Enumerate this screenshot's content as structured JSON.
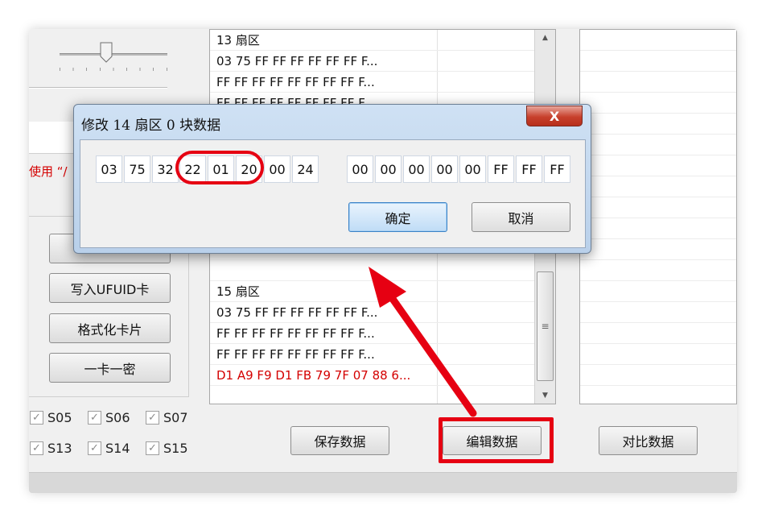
{
  "left_panel": {
    "red_note": "使用 “/",
    "buttons": [
      "",
      "写入UFUID卡",
      "格式化卡片",
      "一卡一密"
    ]
  },
  "checkboxes": [
    {
      "label": "S05",
      "checked": true
    },
    {
      "label": "S06",
      "checked": true
    },
    {
      "label": "S07",
      "checked": true
    },
    {
      "label": "S13",
      "checked": true
    },
    {
      "label": "S14",
      "checked": true
    },
    {
      "label": "S15",
      "checked": true
    }
  ],
  "sector_grid": {
    "rows": [
      {
        "text": "13 扇区",
        "style": "normal"
      },
      {
        "text": "03 75 FF FF FF FF FF FF F...",
        "style": "normal"
      },
      {
        "text": "FF FF FF FF FF FF FF FF F...",
        "style": "normal"
      },
      {
        "text": "FF FF FF FF FF FF FF FF F...",
        "style": "normal"
      },
      {
        "text": "D1 A9 F9 D1 FB 79 7F 07 88 6...",
        "style": "red"
      },
      {
        "text": "",
        "style": "normal"
      },
      {
        "text": "",
        "style": "normal"
      },
      {
        "text": "",
        "style": "normal"
      },
      {
        "text": "",
        "style": "normal"
      },
      {
        "text": "",
        "style": "normal"
      },
      {
        "text": "D1 A9 F9 D1 FB 79 7F 07 88 6...",
        "style": "red dim"
      },
      {
        "text": "",
        "style": "normal"
      },
      {
        "text": "15 扇区",
        "style": "normal"
      },
      {
        "text": "03 75 FF FF FF FF FF FF F...",
        "style": "normal"
      },
      {
        "text": "FF FF FF FF FF FF FF FF F...",
        "style": "normal"
      },
      {
        "text": "FF FF FF FF FF FF FF FF F...",
        "style": "normal"
      },
      {
        "text": "D1 A9 F9 D1 FB 79 7F 07 88 6...",
        "style": "red"
      }
    ]
  },
  "bottom_buttons": {
    "save": "保存数据",
    "edit": "编辑数据",
    "compare": "对比数据"
  },
  "dialog": {
    "title": "修改 14 扇区 0 块数据",
    "close_label": "X",
    "bytes_left": [
      "03",
      "75",
      "32",
      "22",
      "01",
      "20",
      "00",
      "24"
    ],
    "bytes_right": [
      "00",
      "00",
      "00",
      "00",
      "00",
      "FF",
      "FF",
      "FF"
    ],
    "ok_label": "确定",
    "cancel_label": "取消"
  },
  "colors": {
    "highlight_red": "#e60012",
    "data_red": "#d40000",
    "dialog_frame": "#b9d0ea"
  }
}
